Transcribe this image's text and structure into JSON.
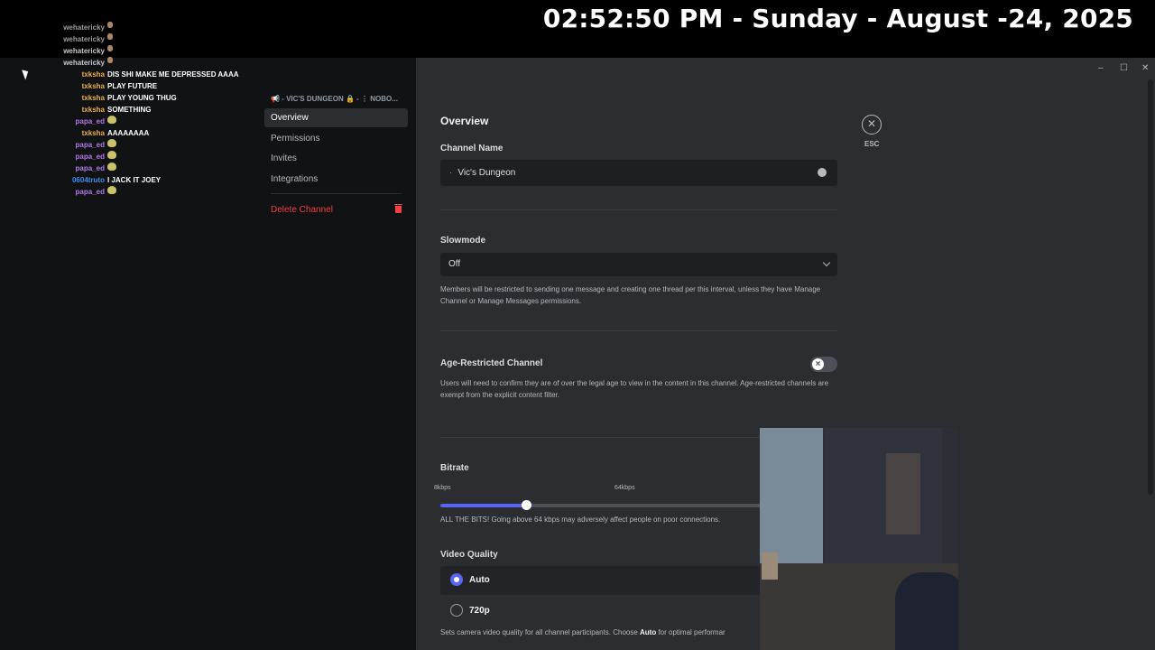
{
  "clock": "02:52:50 PM - Sunday - August -24, 2025",
  "chat": [
    {
      "user": "wehatericky",
      "text": "",
      "emote": "small",
      "color": "#9a9aa0"
    },
    {
      "user": "wehatericky",
      "text": "",
      "emote": "small",
      "color": "#9a9aa0"
    },
    {
      "user": "wehatericky",
      "text": "",
      "emote": "small",
      "color": "#c8c8cc"
    },
    {
      "user": "wehatericky",
      "text": "",
      "emote": "small",
      "color": "#c8c8cc"
    },
    {
      "user": "txksha",
      "text": "DIS SHI MAKE ME DEPRESSED AAAA",
      "emote": "",
      "color": "#e8b04a"
    },
    {
      "user": "txksha",
      "text": "PLAY FUTURE",
      "emote": "",
      "color": "#e8b04a"
    },
    {
      "user": "txksha",
      "text": "PLAY YOUNG THUG",
      "emote": "",
      "color": "#e8b04a"
    },
    {
      "user": "txksha",
      "text": "SOMETHING",
      "emote": "",
      "color": "#e8b04a"
    },
    {
      "user": "papa_ed",
      "text": "",
      "emote": "frog",
      "color": "#b07ae8"
    },
    {
      "user": "txksha",
      "text": "AAAAAAAA",
      "emote": "",
      "color": "#e8b04a"
    },
    {
      "user": "papa_ed",
      "text": "",
      "emote": "frog",
      "color": "#b07ae8"
    },
    {
      "user": "papa_ed",
      "text": "",
      "emote": "frog",
      "color": "#b07ae8"
    },
    {
      "user": "papa_ed",
      "text": "",
      "emote": "frog",
      "color": "#b07ae8"
    },
    {
      "user": "0604truto",
      "text": "I JACK IT JOEY",
      "emote": "",
      "color": "#3b8beb"
    },
    {
      "user": "papa_ed",
      "text": "",
      "emote": "frog",
      "color": "#b07ae8"
    }
  ],
  "sidebar": {
    "header": "📢 - VIC'S DUNGEON 🔒 - ⋮ NOBO...",
    "items": [
      {
        "label": "Overview",
        "active": true
      },
      {
        "label": "Permissions",
        "active": false
      },
      {
        "label": "Invites",
        "active": false
      },
      {
        "label": "Integrations",
        "active": false
      }
    ],
    "delete_label": "Delete Channel"
  },
  "main": {
    "title": "Overview",
    "channel_name_label": "Channel Name",
    "channel_name_prefix": "·",
    "channel_name_value": "Vic's Dungeon",
    "slowmode_label": "Slowmode",
    "slowmode_value": "Off",
    "slowmode_desc": "Members will be restricted to sending one message and creating one thread per this interval, unless they have Manage Channel or Manage Messages permissions.",
    "age_label": "Age-Restricted Channel",
    "age_toggle_on": false,
    "age_desc": "Users will need to confirm they are of over the legal age to view in the content in this channel. Age-restricted channels are exempt from the explicit content filter.",
    "bitrate_label": "Bitrate",
    "bitrate_min": "8kbps",
    "bitrate_mark": "64kbps",
    "bitrate_fraction": 0.216,
    "bitrate_desc": "ALL THE BITS! Going above 64 kbps may adversely affect people on poor connections.",
    "video_quality_label": "Video Quality",
    "video_options": [
      {
        "label": "Auto",
        "selected": true
      },
      {
        "label": "720p",
        "selected": false
      }
    ],
    "video_desc_pre": "Sets camera video quality for all channel participants. Choose ",
    "video_desc_bold": "Auto",
    "video_desc_post": " for optimal performar"
  },
  "esc_label": "ESC",
  "window": {
    "minimize": "–",
    "maximize": "☐",
    "close": "✕"
  }
}
